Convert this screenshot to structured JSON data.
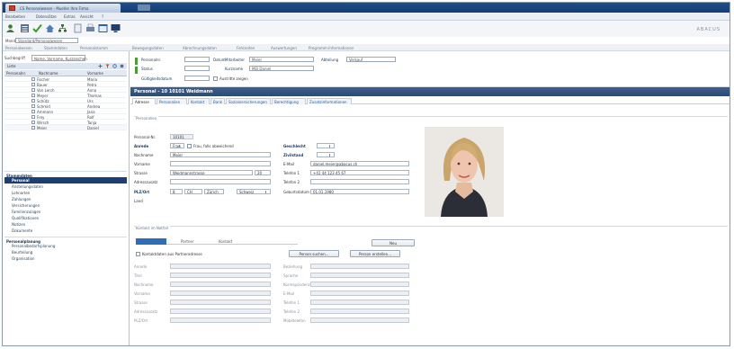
{
  "window": {
    "tab_title": "CS Personalwesen - Mueller Ihre Firma",
    "second_tab": ""
  },
  "menu": [
    "Bearbeiten",
    "Datensätze",
    "Extras",
    "Ansicht",
    "?"
  ],
  "brand": "ABACUS",
  "address": {
    "label": "Mand.",
    "value": "Standard/Personalwesen"
  },
  "breadcrumb": [
    "Personalwesen",
    "Stammdaten",
    "Personalstamm",
    "Bewegungsdaten",
    "Abrechnungsdaten",
    "Fehlzeiten",
    "Auswertungen",
    "Programm-Informationen"
  ],
  "left": {
    "search_label": "Suchbegriff",
    "search_value": "Name, Vorname, Kurzzeichen",
    "tools_label": "Liste",
    "columns": [
      "Personalnr.",
      "Nachname",
      "Vorname"
    ],
    "rows": [
      {
        "c1": "Fischer",
        "c2": "Maria",
        "sel": false
      },
      {
        "c1": "Bauer",
        "c2": "Petra",
        "sel": false
      },
      {
        "c1": "Von Lerch",
        "c2": "Anna",
        "sel": false
      },
      {
        "c1": "Meyer",
        "c2": "Thomas",
        "sel": false
      },
      {
        "c1": "Schütz",
        "c2": "Urs",
        "sel": false
      },
      {
        "c1": "Schmid",
        "c2": "Andrea",
        "sel": false
      },
      {
        "c1": "Ammann",
        "c2": "Jana",
        "sel": false
      },
      {
        "c1": "Frey",
        "c2": "Rolf",
        "sel": false
      },
      {
        "c1": "Wirsch",
        "c2": "Tanja",
        "sel": false
      },
      {
        "c1": "Meier",
        "c2": "Daniel",
        "sel": true
      }
    ],
    "nav": [
      {
        "type": "group",
        "label": "Stammdaten"
      },
      {
        "type": "item",
        "label": "Personal",
        "active": true
      },
      {
        "type": "item",
        "label": "Anstellungsdaten",
        "active": false
      },
      {
        "type": "item",
        "label": "Lohnarten",
        "active": false
      },
      {
        "type": "item",
        "label": "Zahlungen",
        "active": false
      },
      {
        "type": "item",
        "label": "Versicherungen",
        "active": false
      },
      {
        "type": "item",
        "label": "Familienzulagen",
        "active": false
      },
      {
        "type": "item",
        "label": "Qualifikationen",
        "active": false
      },
      {
        "type": "item",
        "label": "Notizen",
        "active": false
      },
      {
        "type": "item",
        "label": "Dokumente",
        "active": false
      },
      {
        "type": "group",
        "label": "Personalplanung"
      },
      {
        "type": "item",
        "label": "Personalbedarfsplanung",
        "active": false
      },
      {
        "type": "item",
        "label": "Beurteilung",
        "active": false
      },
      {
        "type": "item",
        "label": "Organisation",
        "active": false
      }
    ]
  },
  "filters": {
    "personalnr_label": "Personalnr.",
    "personalnr_value": "",
    "status_label": "Status",
    "status_value": "",
    "datum_label": "Datum",
    "datum_value": "",
    "mitarbeiter_label": "Mitarbeiter",
    "mitarbeiter_value": "Meier",
    "kurzname_label": "Kurzname",
    "kurzname_value": "MEI Daniel",
    "abteilung_label": "Abteilung",
    "abteilung_value": "Verkauf",
    "gueltig_label": "Gültigkeitsdatum",
    "gueltig_value": "",
    "check_label": "Austritte zeigen"
  },
  "page_title": "Personal - 10 10101 Weidmann",
  "subtabs": [
    "Adresse",
    "Personalien",
    "Kontakt",
    "Bank",
    "Sozialversicherungen",
    "Berechtigung",
    "Zusatzinformationen"
  ],
  "personal_section": {
    "title": "Personalien",
    "personalnr_label": "Personal-Nr.",
    "personalnr_value": "10101",
    "anrede_label": "Anrede",
    "anrede_value": "Frau",
    "anrede_check_label": "Frau, falls abweichend",
    "nachname_label": "Nachname",
    "nachname_value": "Meier",
    "vorname_label": "Vorname",
    "vorname_value": "",
    "strasse_label": "Strasse",
    "strasse_value": "Weidmannstrasse",
    "strasse_nr": "20",
    "zusatz_label": "Adresszusatz",
    "zusatz_value": "",
    "plz_label": "PLZ/Ort",
    "plz_value": "8",
    "ort_value": "Zürich",
    "land_label": "Land",
    "land_value": "CH",
    "kanton_value": "Schweiz",
    "geschlecht_label": "Geschlecht",
    "zivil_label": "Zivilstand",
    "email_label": "E-Mail",
    "email_value": "daniel.meier@abacus.ch",
    "tel1_label": "Telefon 1",
    "tel1_value": "+41 44 123 45 67",
    "tel2_label": "Telefon 2",
    "tel2_value": "",
    "geb_label": "Geburtsdatum",
    "geb_value": "01.01.1980"
  },
  "emergency_section": {
    "title": "Kontakt im Notfall",
    "tabs": [
      "",
      "Partner",
      "Kontakt"
    ],
    "btn_new": "Neu",
    "btn_search": "Person suchen...",
    "btn_create": "Person erstellen...",
    "check_label": "Kontaktdaten aus Partneradresse",
    "labels_left": [
      "Anrede",
      "Titel",
      "Nachname",
      "Vorname",
      "Strasse",
      "Adresszusatz",
      "PLZ/Ort"
    ],
    "labels_right": [
      "Beziehung",
      "Sprache",
      "Korrespondenz",
      "E-Mail",
      "Telefon 1",
      "Telefon 2",
      "Mobiltelefon"
    ]
  }
}
